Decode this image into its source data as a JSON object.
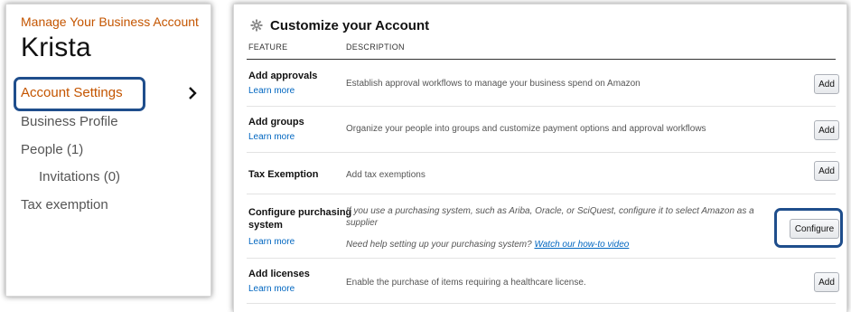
{
  "sidebar": {
    "manage_title": "Manage Your Business Account",
    "user_name": "Krista",
    "items": [
      {
        "label": "Account Settings",
        "active": true
      },
      {
        "label": "Business Profile"
      },
      {
        "label": "People (1)"
      },
      {
        "label": "Invitations (0)"
      },
      {
        "label": "Tax exemption"
      }
    ],
    "active_icon": "chevron-right-icon"
  },
  "main": {
    "title": "Customize your Account",
    "title_icon": "gear-icon",
    "columns": {
      "feature": "FEATURE",
      "description": "DESCRIPTION"
    },
    "rows": [
      {
        "feature": "Add approvals",
        "learn_more": "Learn more",
        "description": "Establish approval workflows to manage your business spend on Amazon",
        "button": "Add"
      },
      {
        "feature": "Add groups",
        "learn_more": "Learn more",
        "description": "Organize your people into groups and customize payment options and approval workflows",
        "button": "Add"
      },
      {
        "feature": "Tax Exemption",
        "description": "Add tax exemptions",
        "button": "Add"
      },
      {
        "feature": "Configure purchasing system",
        "learn_more": "Learn more",
        "description": "If you use a purchasing system, such as Ariba, Oracle, or SciQuest, configure it to select Amazon as a supplier",
        "help_text": "Need help setting up your purchasing system?",
        "help_link": "Watch our how-to video",
        "button": "Configure"
      },
      {
        "feature": "Add licenses",
        "learn_more": "Learn more",
        "description": "Enable the purchase of items requiring a healthcare license.",
        "button": "Add"
      }
    ]
  },
  "colors": {
    "accent_orange": "#c45500",
    "link_blue": "#0066c0",
    "highlight_blue": "#1f4e8c"
  }
}
